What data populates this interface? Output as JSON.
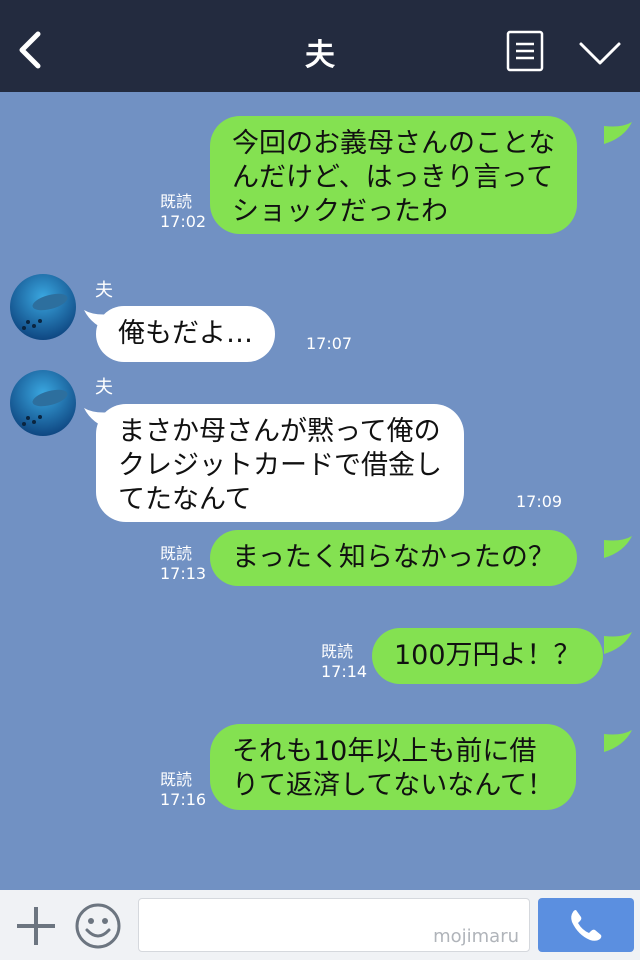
{
  "header": {
    "title": "夫",
    "icons": {
      "back": "chevron-left-icon",
      "menu": "list-icon",
      "collapse": "chevron-down-icon"
    }
  },
  "messages": [
    {
      "type": "sent",
      "lines": [
        "今回のお義母さんのことな",
        "んだけど、はっきり言って",
        "ショックだったわ"
      ],
      "read": "既読",
      "time": "17:02"
    },
    {
      "type": "received",
      "sender": "夫",
      "lines": [
        "俺もだよ…"
      ],
      "time": "17:07"
    },
    {
      "type": "received",
      "sender": "夫",
      "lines": [
        "まさか母さんが黙って俺の",
        "クレジットカードで借金し",
        "てたなんて"
      ],
      "time": "17:09"
    },
    {
      "type": "sent",
      "lines": [
        "まったく知らなかったの？"
      ],
      "read": "既読",
      "time": "17:13"
    },
    {
      "type": "sent",
      "lines": [
        "100万円よ！？"
      ],
      "read": "既読",
      "time": "17:14"
    },
    {
      "type": "sent",
      "lines": [
        "それも10年以上も前に借",
        "りて返済してないなんて！"
      ],
      "read": "既読",
      "time": "17:16"
    }
  ],
  "footer": {
    "icons": {
      "add": "plus-icon",
      "emoji": "smiley-icon",
      "call": "phone-icon"
    },
    "input_value": "",
    "watermark": "mojimaru"
  },
  "colors": {
    "header_bg": "#232b3f",
    "chat_bg": "#7191c3",
    "sent_bubble": "#84e151",
    "received_bubble": "#ffffff",
    "call_button": "#5b8fe0"
  }
}
